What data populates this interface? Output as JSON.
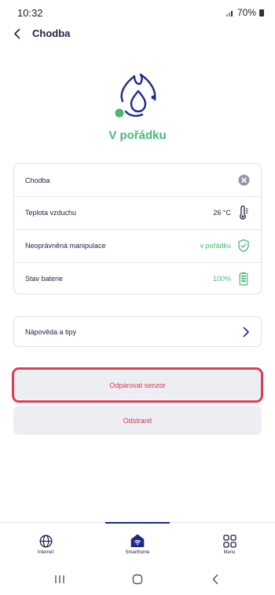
{
  "status_bar": {
    "time": "10:32",
    "battery": "70%"
  },
  "header": {
    "title": "Chodba"
  },
  "status": {
    "label": "V pořádku"
  },
  "rows": [
    {
      "label": "Chodba",
      "value": "",
      "icon": "close-circle-icon"
    },
    {
      "label": "Teplota vzduchu",
      "value": "26 °C",
      "icon": "thermometer-icon"
    },
    {
      "label": "Neoprávněná manipulace",
      "value": "v pořádku",
      "icon": "shield-check-icon"
    },
    {
      "label": "Stav baterie",
      "value": "100%",
      "icon": "battery-icon"
    }
  ],
  "help": {
    "label": "Nápověda a tipy"
  },
  "buttons": {
    "unpair": "Odpárovat senzor",
    "remove": "Odstranit"
  },
  "tabs": [
    {
      "label": "Internet",
      "icon": "globe-icon"
    },
    {
      "label": "Smarthome",
      "icon": "home-wifi-icon"
    },
    {
      "label": "Menu",
      "icon": "grid-icon"
    }
  ],
  "colors": {
    "accent": "#1e2a8a",
    "ok": "#49b87a",
    "danger": "#e5334e",
    "highlight": "#e23a50"
  }
}
